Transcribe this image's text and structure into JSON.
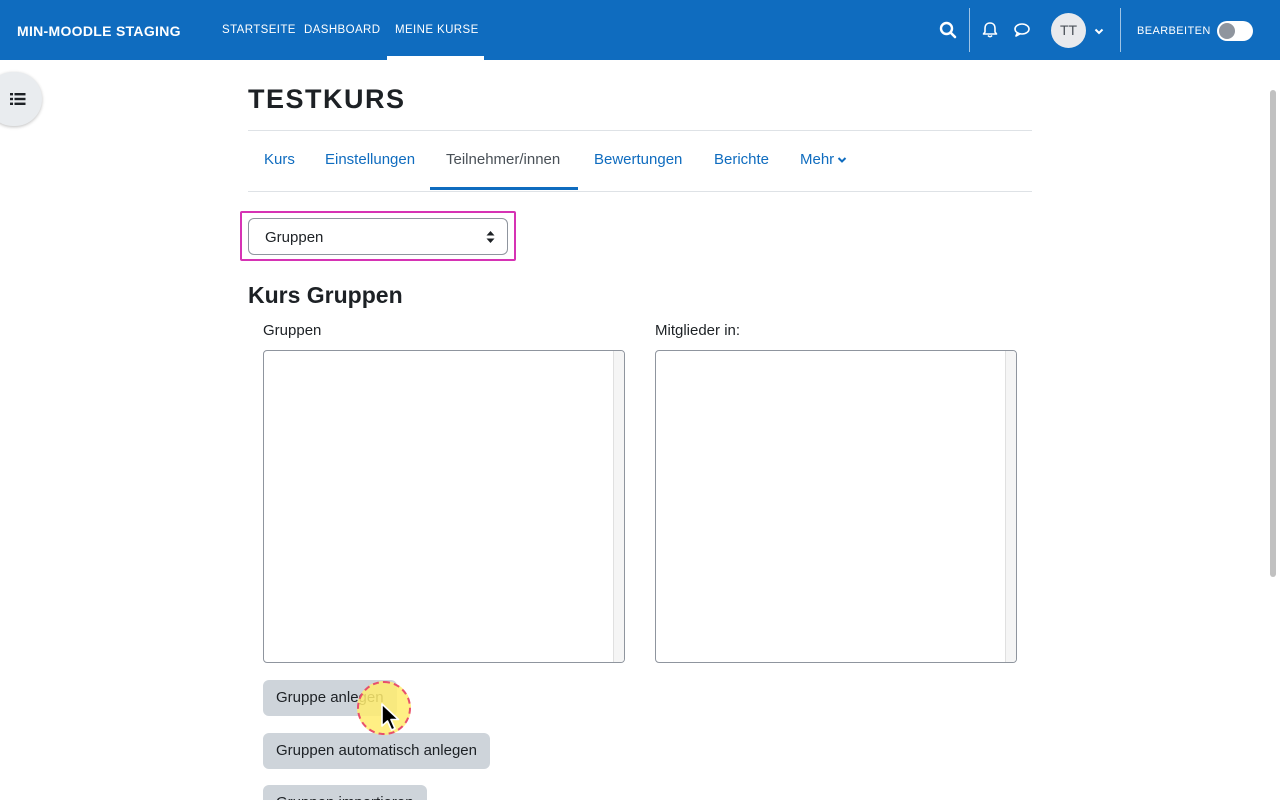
{
  "navbar": {
    "brand": "MIN-MOODLE STAGING",
    "links": [
      {
        "label": "STARTSEITE"
      },
      {
        "label": "DASHBOARD"
      },
      {
        "label": "MEINE KURSE"
      }
    ],
    "avatar_initials": "TT",
    "edit_label": "BEARBEITEN",
    "edit_mode_on": false
  },
  "course": {
    "title": "TESTKURS"
  },
  "secondary_nav": {
    "items": [
      {
        "label": "Kurs"
      },
      {
        "label": "Einstellungen"
      },
      {
        "label": "Teilnehmer/innen"
      },
      {
        "label": "Bewertungen"
      },
      {
        "label": "Berichte"
      },
      {
        "label": "Mehr"
      }
    ],
    "active": "Teilnehmer/innen"
  },
  "page_select": {
    "value": "Gruppen"
  },
  "groups": {
    "heading": "Kurs Gruppen",
    "groups_label": "Gruppen",
    "members_label": "Mitglieder in:",
    "buttons": {
      "create": "Gruppe anlegen",
      "auto_create": "Gruppen automatisch anlegen",
      "import": "Gruppen importieren"
    }
  },
  "colors": {
    "primary": "#0f6cbf",
    "highlight": "#d633b4",
    "button_bg": "#ced4da"
  }
}
